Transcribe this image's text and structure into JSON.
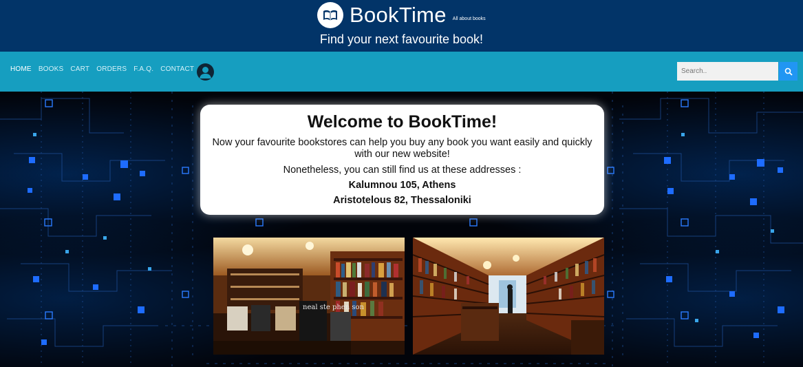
{
  "header": {
    "brand_name": "BookTime",
    "brand_tag": "All about books",
    "tagline": "Find your next favourite book!",
    "logo_icon": "open-book-icon"
  },
  "nav": {
    "links": [
      "HOME",
      "BOOKS",
      "CART",
      "ORDERS",
      "F.A.Q.",
      "CONTACT"
    ],
    "active": "HOME",
    "user_icon": "user-account-icon"
  },
  "search": {
    "placeholder": "Search..",
    "icon": "search-icon"
  },
  "welcome": {
    "title": "Welcome to BookTime!",
    "intro": "Now your favourite bookstores can help you buy any book you want easily and quickly with our new website!",
    "note": "Nonetheless, you can still find us at these addresses :",
    "addresses": [
      "Kalumnou 105, Athens",
      "Aristotelous 82, Thessaloniki"
    ]
  },
  "photos": {
    "left_book_label": "neal ste phen son"
  },
  "colors": {
    "header_bg": "#023468",
    "nav_bg": "#169ec0",
    "search_button": "#2196f3",
    "circuit": "#1e6cff"
  }
}
